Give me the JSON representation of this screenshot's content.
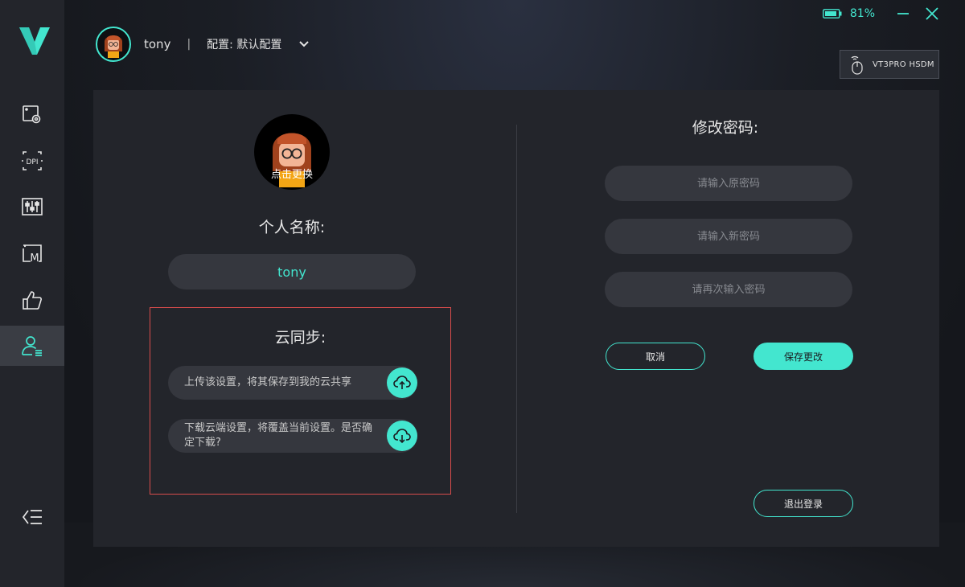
{
  "colors": {
    "accent": "#43e6cf",
    "sidebar_bg": "#23252b",
    "card_bg": "#23252b",
    "field_bg": "#35373e",
    "highlight_border": "#d94c4c"
  },
  "sidebar": {
    "items": [
      {
        "icon": "screen-settings-icon"
      },
      {
        "icon": "dpi-icon",
        "label": "DPI"
      },
      {
        "icon": "sliders-icon"
      },
      {
        "icon": "macro-icon",
        "label": "M"
      },
      {
        "icon": "thumbs-up-icon"
      },
      {
        "icon": "user-profile-icon",
        "active": true
      }
    ],
    "collapse_icon": "collapse-menu-icon"
  },
  "topbar": {
    "battery": "81%",
    "user_name": "tony",
    "separator": "|",
    "config_label": "配置: 默认配置",
    "device_name": "VT3PRO HSDM"
  },
  "profile": {
    "avatar_caption": "点击更换",
    "name_label": "个人名称:",
    "name_value": "tony"
  },
  "cloud_sync": {
    "title": "云同步:",
    "upload_text": "上传该设置，将其保存到我的云共享",
    "download_text": "下载云端设置，将覆盖当前设置。是否确定下载?"
  },
  "password": {
    "title": "修改密码:",
    "old_placeholder": "请输入原密码",
    "new_placeholder": "请输入新密码",
    "confirm_placeholder": "请再次输入密码",
    "cancel_label": "取消",
    "save_label": "保存更改",
    "logout_label": "退出登录"
  }
}
